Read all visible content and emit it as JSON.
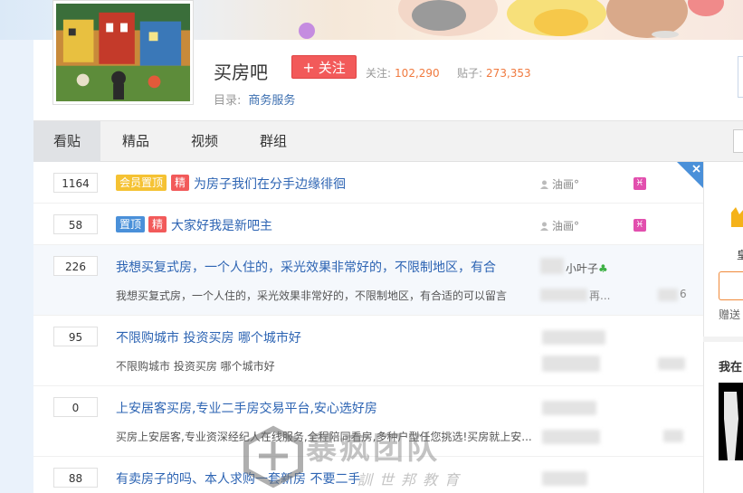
{
  "forum": {
    "name": "买房吧",
    "follow_label": "关注",
    "stats": {
      "follow_label": "关注:",
      "follow_value": "102,290",
      "posts_label": "贴子:",
      "posts_value": "273,353"
    },
    "dir_label": "目录:",
    "dir_value": "商务服务"
  },
  "tabs": [
    {
      "label": "看贴",
      "active": true
    },
    {
      "label": "精品"
    },
    {
      "label": "视频"
    },
    {
      "label": "群组"
    }
  ],
  "threads": [
    {
      "count": "1164",
      "badges": [
        {
          "text": "会员置顶",
          "type": "vip"
        },
        {
          "text": "精",
          "type": "jing"
        }
      ],
      "title": "为房子我们在分手边缘徘徊",
      "author": "油画°"
    },
    {
      "count": "58",
      "badges": [
        {
          "text": "置顶",
          "type": "top"
        },
        {
          "text": "精",
          "type": "jing"
        }
      ],
      "title": "大家好我是新吧主",
      "author": "油画°"
    },
    {
      "count": "226",
      "title": "我想买复式房，一个人住的，采光效果非常好的，不限制地区，有合",
      "excerpt": "我想买复式房，一个人住的，采光效果非常好的，不限制地区，有合适的可以留言",
      "author": "小叶子",
      "reply_author": "再...",
      "reply_time": "6"
    },
    {
      "count": "95",
      "title": "不限购城市 投资买房 哪个城市好",
      "excerpt": "不限购城市 投资买房 哪个城市好"
    },
    {
      "count": "0",
      "title": "上安居客买房,专业二手房交易平台,安心选好房",
      "excerpt": "买房上安居客,专业资深经纪人在线服务,全程陪同看房,多种户型任您挑选!买房就上安..."
    },
    {
      "count": "88",
      "title": "有卖房子的吗、本人求购一套新房 不要二手"
    }
  ],
  "sidebar": {
    "char1": "皇",
    "char2": "赠送",
    "heading": "我在"
  },
  "watermark": {
    "main": "暴疯团队",
    "sub": "訓世邦教育"
  },
  "colors": {
    "link": "#2d64b3",
    "follow_button": "#f25a5a",
    "stat_value": "#f07a3f",
    "vip_badge": "#f5c233",
    "top_badge": "#4a90d9",
    "jing_badge": "#f25a5a"
  }
}
